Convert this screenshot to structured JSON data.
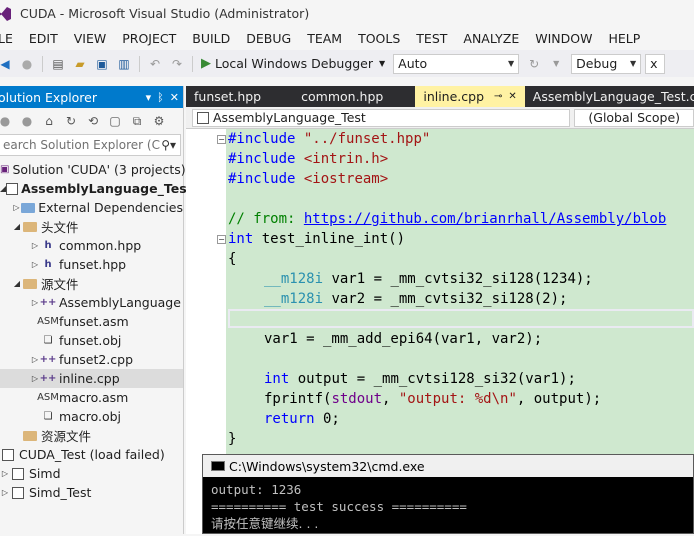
{
  "window": {
    "title": "CUDA - Microsoft Visual Studio (Administrator)"
  },
  "menu": [
    "LE",
    "EDIT",
    "VIEW",
    "PROJECT",
    "BUILD",
    "DEBUG",
    "TEAM",
    "TOOLS",
    "TEST",
    "ANALYZE",
    "WINDOW",
    "HELP"
  ],
  "toolbar": {
    "debugger_label": "Local Windows Debugger",
    "solution_platform": "Auto",
    "configuration": "Debug",
    "extra": "x"
  },
  "solution_explorer": {
    "title": "olution Explorer",
    "search_placeholder": "earch Solution Explorer (C",
    "items": [
      {
        "label": "Solution 'CUDA' (3 projects)",
        "kind": "solution"
      },
      {
        "label": "AssemblyLanguage_Test",
        "kind": "project",
        "bold": true
      },
      {
        "label": "External Dependencies",
        "kind": "ext"
      },
      {
        "label": "头文件",
        "kind": "folder"
      },
      {
        "label": "common.hpp",
        "kind": "h"
      },
      {
        "label": "funset.hpp",
        "kind": "h"
      },
      {
        "label": "源文件",
        "kind": "folder"
      },
      {
        "label": "AssemblyLanguage",
        "kind": "cpp"
      },
      {
        "label": "funset.asm",
        "kind": "asm"
      },
      {
        "label": "funset.obj",
        "kind": "obj"
      },
      {
        "label": "funset2.cpp",
        "kind": "cpp"
      },
      {
        "label": "inline.cpp",
        "kind": "cpp",
        "selected": true
      },
      {
        "label": "macro.asm",
        "kind": "asm"
      },
      {
        "label": "macro.obj",
        "kind": "obj"
      },
      {
        "label": "资源文件",
        "kind": "folder"
      },
      {
        "label": "CUDA_Test (load failed)",
        "kind": "project"
      },
      {
        "label": "Simd",
        "kind": "project"
      },
      {
        "label": "Simd_Test",
        "kind": "project"
      }
    ]
  },
  "editor": {
    "tabs": [
      "funset.hpp",
      "common.hpp",
      "inline.cpp",
      "AssemblyLanguage_Test.cp"
    ],
    "active_tab": "inline.cpp",
    "nav_project": "AssemblyLanguage_Test",
    "nav_scope": "(Global Scope)",
    "code": {
      "inc1_kw": "#include",
      "inc1_str": "\"../funset.hpp\"",
      "inc2_kw": "#include",
      "inc2_str": "<intrin.h>",
      "inc3_kw": "#include",
      "inc3_str": "<iostream>",
      "cm_prefix": "// from: ",
      "cm_link": "https://github.com/brianrhall/Assembly/blob",
      "fn_kw": "int",
      "fn_rest": " test_inline_int()",
      "brace_open": "{",
      "v1_type": "__m128i",
      "v1_rest": " var1 = _mm_cvtsi32_si128(1234);",
      "v2_type": "__m128i",
      "v2_rest": " var2 = _mm_cvtsi32_si128(2);",
      "add": "var1 = _mm_add_epi64(var1, var2);",
      "out_kw": "int",
      "out_rest": " output = _mm_cvtsi128_si32(var1);",
      "pf_a": "fprintf(",
      "pf_stdout": "stdout",
      "pf_b": ", ",
      "pf_str": "\"output: %d\\n\"",
      "pf_c": ", output);",
      "ret_kw": "return",
      "ret_rest": " 0;",
      "brace_close": "}"
    }
  },
  "console": {
    "title": "C:\\Windows\\system32\\cmd.exe",
    "lines": [
      "output: 1236",
      "========== test success ==========",
      "请按任意键继续. . ."
    ]
  }
}
